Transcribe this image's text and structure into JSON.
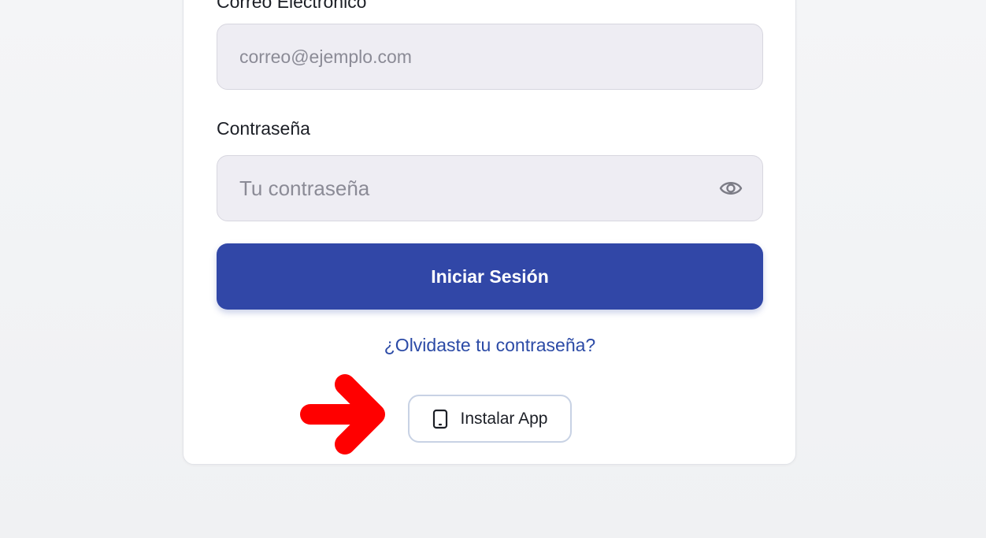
{
  "form": {
    "email_label": "Correo Electrónico",
    "email_placeholder": "correo@ejemplo.com",
    "password_label": "Contraseña",
    "password_placeholder": "Tu contraseña",
    "login_label": "Iniciar Sesión",
    "forgot_label": "¿Olvidaste tu contraseña?",
    "install_label": "Instalar App"
  },
  "icons": {
    "password_toggle": "eye-icon",
    "install": "smartphone-icon",
    "annotation": "arrow-right-icon"
  },
  "colors": {
    "primary": "#3147a7",
    "link": "#2b4aa6",
    "input_bg": "#eeedf3",
    "annotation_arrow": "#ff0000"
  }
}
